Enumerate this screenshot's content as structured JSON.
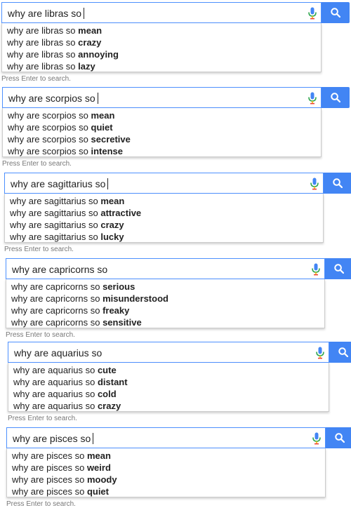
{
  "search_button_icon": "search-icon",
  "mic_icon": "microphone-icon",
  "accent_color": "#4285f4",
  "blocks": [
    {
      "query": "why are libras so",
      "suggestions": [
        {
          "prefix": "why are libras so ",
          "completion": "mean"
        },
        {
          "prefix": "why are libras so ",
          "completion": "crazy"
        },
        {
          "prefix": "why are libras so ",
          "completion": "annoying"
        },
        {
          "prefix": "why are libras so ",
          "completion": "lazy"
        }
      ],
      "hint": "Press Enter to search."
    },
    {
      "query": "why are scorpios so",
      "suggestions": [
        {
          "prefix": "why are scorpios so ",
          "completion": "mean"
        },
        {
          "prefix": "why are scorpios so ",
          "completion": "quiet"
        },
        {
          "prefix": "why are scorpios so ",
          "completion": "secretive"
        },
        {
          "prefix": "why are scorpios so ",
          "completion": "intense"
        }
      ],
      "hint": "Press Enter to search."
    },
    {
      "query": "why are sagittarius so",
      "suggestions": [
        {
          "prefix": "why are sagittarius so ",
          "completion": "mean"
        },
        {
          "prefix": "why are sagittarius so ",
          "completion": "attractive"
        },
        {
          "prefix": "why are sagittarius so ",
          "completion": "crazy"
        },
        {
          "prefix": "why are sagittarius so ",
          "completion": "lucky"
        }
      ],
      "hint": "Press Enter to search."
    },
    {
      "query": "why are capricorns so",
      "suggestions": [
        {
          "prefix": "why are capricorns so ",
          "completion": "serious"
        },
        {
          "prefix": "why are capricorns so ",
          "completion": "misunderstood"
        },
        {
          "prefix": "why are capricorns so ",
          "completion": "freaky"
        },
        {
          "prefix": "why are capricorns so ",
          "completion": "sensitive"
        }
      ],
      "hint": "Press Enter to search."
    },
    {
      "query": "why are aquarius so",
      "suggestions": [
        {
          "prefix": "why are aquarius so ",
          "completion": "cute"
        },
        {
          "prefix": "why are aquarius so ",
          "completion": "distant"
        },
        {
          "prefix": "why are aquarius so ",
          "completion": "cold"
        },
        {
          "prefix": "why are aquarius so ",
          "completion": "crazy"
        }
      ],
      "hint": "Press Enter to search."
    },
    {
      "query": "why are pisces so",
      "suggestions": [
        {
          "prefix": "why are pisces so ",
          "completion": "mean"
        },
        {
          "prefix": "why are pisces so ",
          "completion": "weird"
        },
        {
          "prefix": "why are pisces so ",
          "completion": "moody"
        },
        {
          "prefix": "why are pisces so ",
          "completion": "quiet"
        }
      ],
      "hint": "Press Enter to search."
    }
  ]
}
